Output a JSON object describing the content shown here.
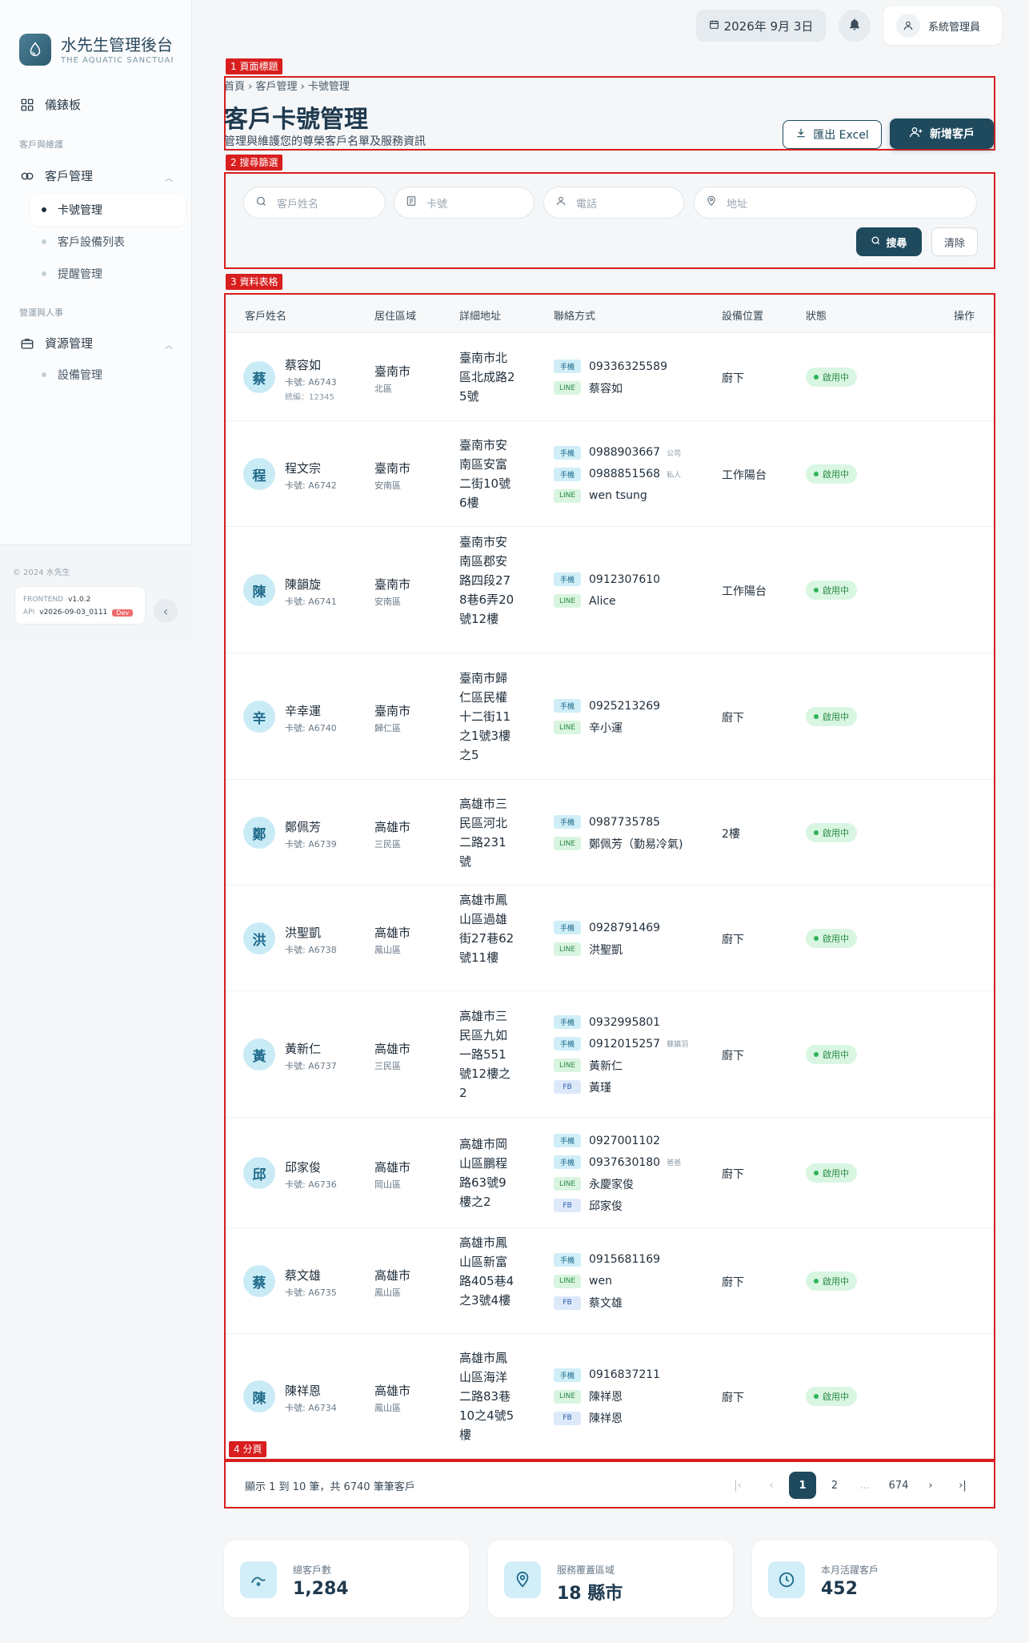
{
  "app": {
    "title": "水先生管理後台",
    "subtitle": "THE AQUATIC SANCTUARY"
  },
  "sidebar": {
    "dashboard": "儀錶板",
    "section_customer": "客戶與維護",
    "customer_mgmt": "客戶管理",
    "sub_items": [
      "卡號管理",
      "客戶設備列表",
      "提醒管理"
    ],
    "section_ops": "營運與人事",
    "resource_mgmt": "資源管理",
    "resource_sub": [
      "設備管理"
    ],
    "copyright": "© 2024 水先生",
    "frontend_label": "FRONTEND",
    "frontend_version": "v1.0.2",
    "api_label": "API",
    "api_version": "v2026-09-03_0111",
    "env_badge": "Dev"
  },
  "topbar": {
    "date": "2026年 9月 3日",
    "user": "系統管理員"
  },
  "annotations": {
    "label1": "1 頁面標題",
    "label2": "2 搜尋篩選",
    "label3": "3 資料表格",
    "label4": "4 分頁"
  },
  "header": {
    "breadcrumb": "首頁 › 客戶管理 › 卡號管理",
    "title": "客戶卡號管理",
    "subtitle": "管理與維護您的尊榮客戶名單及服務資訊",
    "export_label": "匯出 Excel",
    "add_label": "新增客戶"
  },
  "search": {
    "name_placeholder": "客戶姓名",
    "card_placeholder": "卡號",
    "phone_placeholder": "電話",
    "address_placeholder": "地址",
    "search_label": "搜尋",
    "clear_label": "清除"
  },
  "table": {
    "headers": [
      "客戶姓名",
      "居住區域",
      "詳細地址",
      "聯絡方式",
      "設備位置",
      "狀態",
      "操作"
    ],
    "rows": [
      {
        "initial": "蔡",
        "name": "蔡容如",
        "card": "卡號: A6743",
        "tax": "統編：12345",
        "city": "臺南市",
        "district": "北區",
        "address": "臺南市北區北成路25號",
        "contacts": [
          {
            "type": "手機",
            "value": "09336325589",
            "note": ""
          },
          {
            "type": "LINE",
            "value": "蔡容如",
            "note": ""
          }
        ],
        "location": "廚下",
        "status": "啟用中"
      },
      {
        "initial": "程",
        "name": "程文宗",
        "card": "卡號: A6742",
        "tax": "",
        "city": "臺南市",
        "district": "安南區",
        "address": "臺南市安南區安富二街10號6樓",
        "contacts": [
          {
            "type": "手機",
            "value": "0988903667",
            "note": "公司"
          },
          {
            "type": "手機",
            "value": "0988851568",
            "note": "私人"
          },
          {
            "type": "LINE",
            "value": "wen tsung",
            "note": ""
          }
        ],
        "location": "工作陽台",
        "status": "啟用中"
      },
      {
        "initial": "陳",
        "name": "陳韻旋",
        "card": "卡號: A6741",
        "tax": "",
        "city": "臺南市",
        "district": "安南區",
        "address": "臺南市安南區郡安路四段278巷6弄20號12樓",
        "contacts": [
          {
            "type": "手機",
            "value": "0912307610",
            "note": ""
          },
          {
            "type": "LINE",
            "value": "Alice",
            "note": ""
          }
        ],
        "location": "工作陽台",
        "status": "啟用中"
      },
      {
        "initial": "辛",
        "name": "辛幸運",
        "card": "卡號: A6740",
        "tax": "",
        "city": "臺南市",
        "district": "歸仁區",
        "address": "臺南市歸仁區民權十二街11之1號3樓之5",
        "contacts": [
          {
            "type": "手機",
            "value": "0925213269",
            "note": ""
          },
          {
            "type": "LINE",
            "value": "辛小運",
            "note": ""
          }
        ],
        "location": "廚下",
        "status": "啟用中"
      },
      {
        "initial": "鄭",
        "name": "鄭佩芳",
        "card": "卡號: A6739",
        "tax": "",
        "city": "高雄市",
        "district": "三民區",
        "address": "高雄市三民區河北二路231號",
        "contacts": [
          {
            "type": "手機",
            "value": "0987735785",
            "note": ""
          },
          {
            "type": "LINE",
            "value": "鄭佩芳（勤易冷氣)",
            "note": ""
          }
        ],
        "location": "2樓",
        "status": "啟用中"
      },
      {
        "initial": "洪",
        "name": "洪聖凱",
        "card": "卡號: A6738",
        "tax": "",
        "city": "高雄市",
        "district": "鳳山區",
        "address": "高雄市鳳山區過雄街27巷62號11樓",
        "contacts": [
          {
            "type": "手機",
            "value": "0928791469",
            "note": ""
          },
          {
            "type": "LINE",
            "value": "洪聖凱",
            "note": ""
          }
        ],
        "location": "廚下",
        "status": "啟用中"
      },
      {
        "initial": "黃",
        "name": "黃新仁",
        "card": "卡號: A6737",
        "tax": "",
        "city": "高雄市",
        "district": "三民區",
        "address": "高雄市三民區九如一路551號12樓之2",
        "contacts": [
          {
            "type": "手機",
            "value": "0932995801",
            "note": ""
          },
          {
            "type": "手機",
            "value": "0912015257",
            "note": "蘇鎮羽"
          },
          {
            "type": "LINE",
            "value": "黃新仁",
            "note": ""
          },
          {
            "type": "FB",
            "value": "黃瑾",
            "note": ""
          }
        ],
        "location": "廚下",
        "status": "啟用中"
      },
      {
        "initial": "邱",
        "name": "邱家俊",
        "card": "卡號: A6736",
        "tax": "",
        "city": "高雄市",
        "district": "岡山區",
        "address": "高雄市岡山區鵬程路63號9樓之2",
        "contacts": [
          {
            "type": "手機",
            "value": "0927001102",
            "note": ""
          },
          {
            "type": "手機",
            "value": "0937630180",
            "note": "爸爸"
          },
          {
            "type": "LINE",
            "value": "永慶家俊",
            "note": ""
          },
          {
            "type": "FB",
            "value": "邱家俊",
            "note": ""
          }
        ],
        "location": "廚下",
        "status": "啟用中"
      },
      {
        "initial": "蔡",
        "name": "蔡文雄",
        "card": "卡號: A6735",
        "tax": "",
        "city": "高雄市",
        "district": "鳳山區",
        "address": "高雄市鳳山區新富路405巷4之3號4樓",
        "contacts": [
          {
            "type": "手機",
            "value": "0915681169",
            "note": ""
          },
          {
            "type": "LINE",
            "value": "wen",
            "note": ""
          },
          {
            "type": "FB",
            "value": "蔡文雄",
            "note": ""
          }
        ],
        "location": "廚下",
        "status": "啟用中"
      },
      {
        "initial": "陳",
        "name": "陳祥恩",
        "card": "卡號: A6734",
        "tax": "",
        "city": "高雄市",
        "district": "鳳山區",
        "address": "高雄市鳳山區海洋二路83巷10之4號5樓",
        "contacts": [
          {
            "type": "手機",
            "value": "0916837211",
            "note": ""
          },
          {
            "type": "LINE",
            "value": "陳祥恩",
            "note": ""
          },
          {
            "type": "FB",
            "value": "陳祥恩",
            "note": ""
          }
        ],
        "location": "廚下",
        "status": "啟用中"
      }
    ]
  },
  "pagination": {
    "info": "顯示 1 到 10 筆，共 6740 筆筆客戶",
    "pages": [
      "1",
      "2",
      "...",
      "674"
    ]
  },
  "stats": [
    {
      "label": "總客戶數",
      "value": "1,284",
      "icon": "wave-icon"
    },
    {
      "label": "服務覆蓋區域",
      "value": "18 縣市",
      "icon": "map-pin-icon"
    },
    {
      "label": "本月活躍客戶",
      "value": "452",
      "icon": "clock-icon"
    }
  ]
}
